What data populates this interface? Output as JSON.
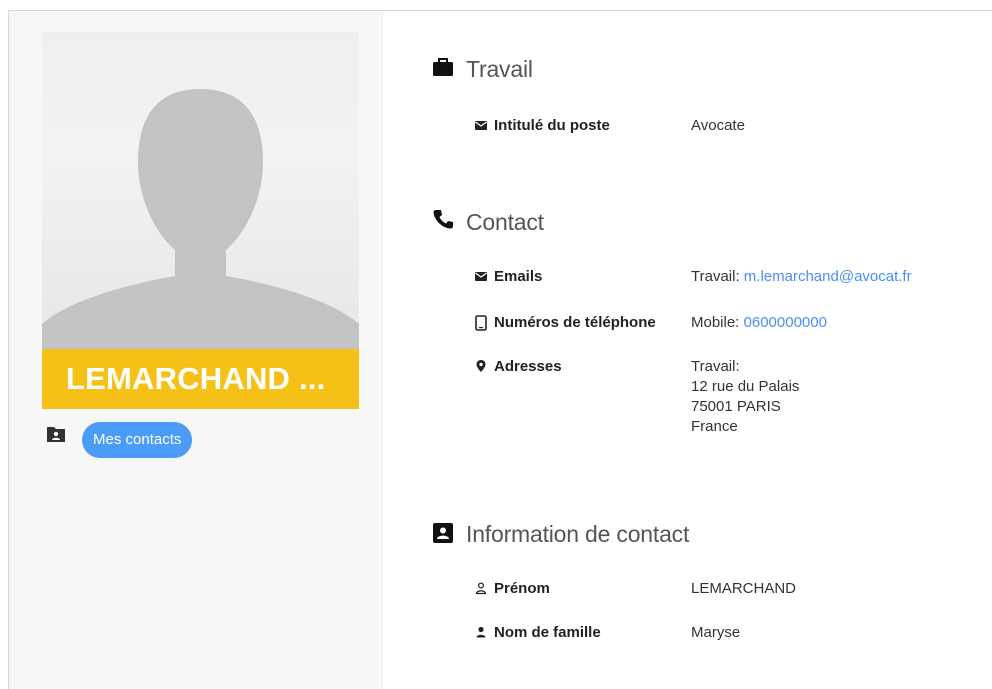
{
  "sidebar": {
    "name": "LEMARCHAND ...",
    "tag": "Mes contacts",
    "colors": {
      "banner": "#f5c116",
      "chip": "#4a9cf6"
    }
  },
  "icons": {
    "folder": "contacts-folder-icon",
    "briefcase": "briefcase-icon",
    "phone": "phone-icon",
    "id_card": "contact-card-icon",
    "envelope": "envelope-icon",
    "mobile": "mobile-phone-icon",
    "pin": "location-pin-icon",
    "person_outline": "person-outline-icon",
    "person": "person-icon"
  },
  "work": {
    "title": "Travail",
    "job_label": "Intitulé du poste",
    "job_value": "Avocate"
  },
  "contact": {
    "title": "Contact",
    "emails_label": "Emails",
    "email_prefix": "Travail: ",
    "email": "m.lemarchand@avocat.fr",
    "phones_label": "Numéros de téléphone",
    "phone_prefix": "Mobile: ",
    "phone": "0600000000",
    "addresses_label": "Adresses",
    "address_lines": [
      "Travail:",
      "12 rue du Palais",
      "75001 PARIS",
      "France"
    ]
  },
  "info": {
    "title": "Information de contact",
    "firstname_label": "Prénom",
    "firstname_value": "LEMARCHAND",
    "lastname_label": "Nom de famille",
    "lastname_value": "Maryse"
  },
  "link_color": "#4a8ff0"
}
